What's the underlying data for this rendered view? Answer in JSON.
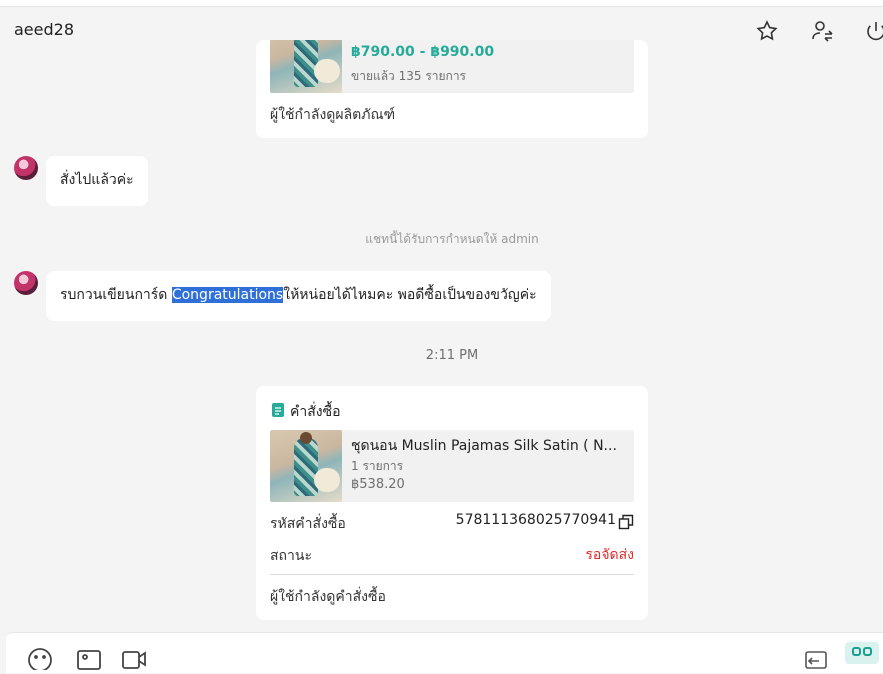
{
  "header": {
    "name": "aeed28",
    "icons": [
      "star-icon",
      "transfer-user-icon",
      "power-icon"
    ]
  },
  "top_product_card": {
    "price": "฿790.00 - ฿990.00",
    "sold": "ขายแล้ว 135 รายการ",
    "viewing": "ผู้ใช้กำลังดูผลิตภัณฑ์"
  },
  "messages": [
    {
      "text": "สั่งไปแล้วค่ะ"
    },
    {
      "before": "รบกวนเขียนการ์ด ",
      "highlight": "Congratulations",
      "after": "ให้หน่อยได้ไหมคะ พอดีซื้อเป็นของขวัญค่ะ"
    }
  ],
  "system_notice": "แชทนี้ได้รับการกำหนดให้ admin",
  "timestamp": "2:11 PM",
  "order_card": {
    "title": "คำสั่งซื้อ",
    "product_name": "ชุดนอน Muslin Pajamas Silk Satin ( N...",
    "quantity": "1 รายการ",
    "price": "฿538.20",
    "order_id_label": "รหัสคำสั่งซื้อ",
    "order_id": "578111368025770941",
    "status_label": "สถานะ",
    "status_value": "รอจัดส่ง",
    "viewing": "ผู้ใช้กำลังดูคำสั่งซื้อ"
  },
  "colors": {
    "accent": "#26aa99",
    "status": "#e02b2b",
    "highlight": "#2f6fd8"
  },
  "bottom_icons": [
    "emoji-icon",
    "image-icon",
    "video-icon",
    "quick-reply-icon",
    "apps-icon"
  ]
}
